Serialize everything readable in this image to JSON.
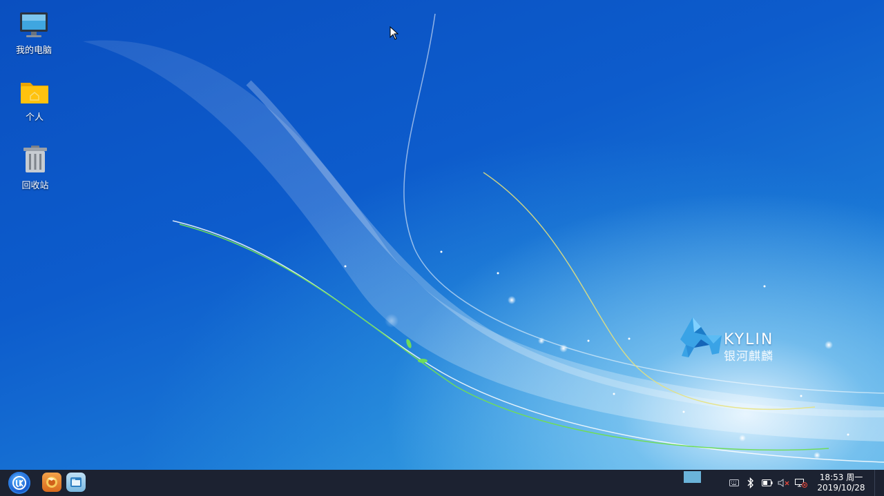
{
  "desktop": {
    "icons": [
      {
        "label": "我的电脑",
        "icon": "computer-icon"
      },
      {
        "label": "个人",
        "icon": "home-folder-icon"
      },
      {
        "label": "回收站",
        "icon": "trash-icon"
      }
    ],
    "wallpaper": {
      "brand": "KYLIN",
      "brand_sub": "银河麒麟",
      "colors": {
        "top": "#0a4fc0",
        "glow": "#e6f5ff",
        "green_line": "#6fdc5a",
        "yellow_line": "#e8e27a"
      }
    }
  },
  "taskbar": {
    "start_icon": "kylin-start-icon",
    "launchers": [
      {
        "name": "browser",
        "icon": "firefox-icon"
      },
      {
        "name": "files",
        "icon": "file-manager-icon"
      }
    ],
    "tray": [
      "keyboard-icon",
      "bluetooth-icon",
      "battery-icon",
      "volume-muted-icon",
      "network-disconnected-icon"
    ],
    "clock": {
      "time": "18:53 周一",
      "date": "2019/10/28"
    },
    "colors": {
      "background": "#1c2231",
      "workspace": "#6ab3d9"
    }
  }
}
